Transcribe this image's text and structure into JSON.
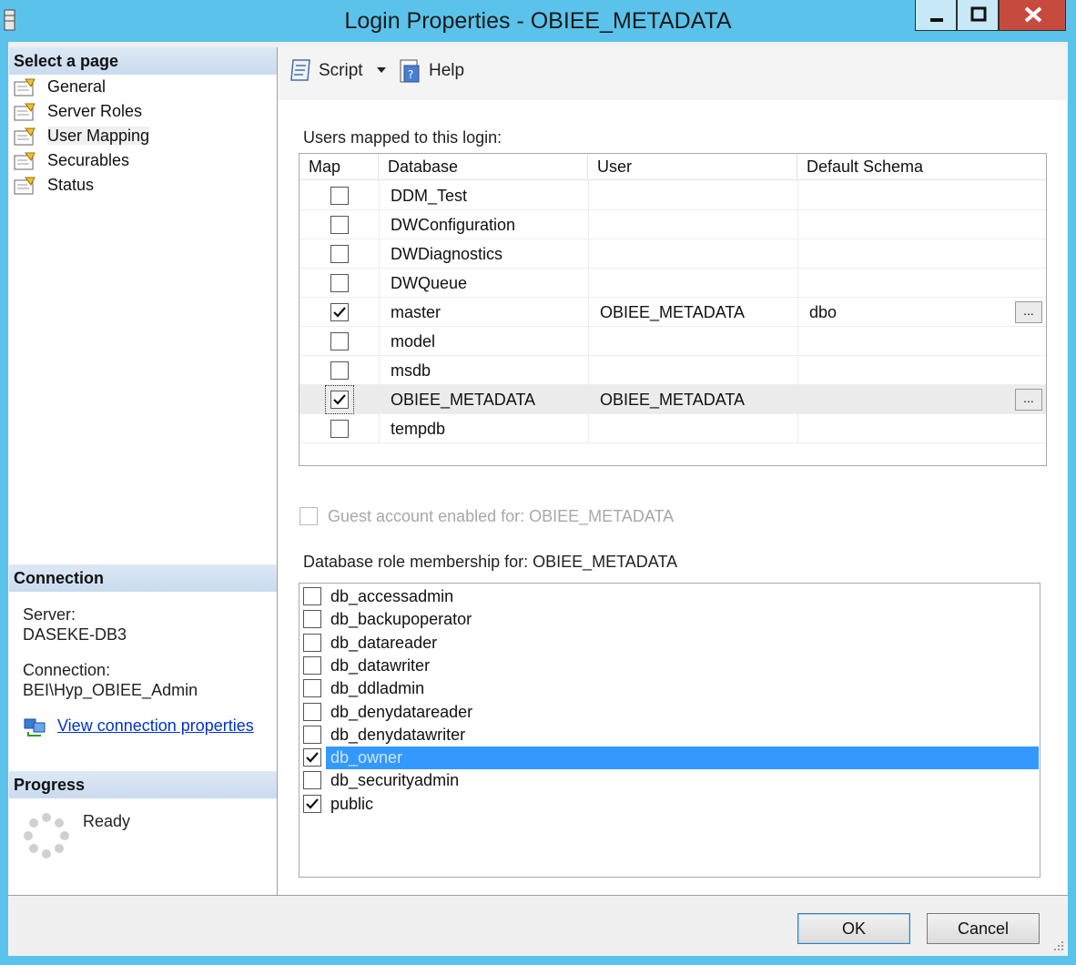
{
  "window": {
    "title": "Login Properties - OBIEE_METADATA"
  },
  "left": {
    "select_page_header": "Select a page",
    "pages": [
      {
        "label": "General"
      },
      {
        "label": "Server Roles"
      },
      {
        "label": "User Mapping"
      },
      {
        "label": "Securables"
      },
      {
        "label": "Status"
      }
    ],
    "connection_header": "Connection",
    "server_label": "Server:",
    "server_value": "DASEKE-DB3",
    "connection_label": "Connection:",
    "connection_value": "BEI\\Hyp_OBIEE_Admin",
    "view_link": "View connection properties",
    "progress_header": "Progress",
    "progress_status": "Ready"
  },
  "toolbar": {
    "script_label": "Script",
    "help_label": "Help"
  },
  "mapping": {
    "label": "Users mapped to this login:",
    "columns": [
      "Map",
      "Database",
      "User",
      "Default Schema"
    ],
    "rows": [
      {
        "checked": false,
        "database": "DDM_Test",
        "user": "",
        "schema": ""
      },
      {
        "checked": false,
        "database": "DWConfiguration",
        "user": "",
        "schema": ""
      },
      {
        "checked": false,
        "database": "DWDiagnostics",
        "user": "",
        "schema": ""
      },
      {
        "checked": false,
        "database": "DWQueue",
        "user": "",
        "schema": ""
      },
      {
        "checked": true,
        "database": "master",
        "user": "OBIEE_METADATA",
        "schema": "dbo",
        "ellipsis": "..."
      },
      {
        "checked": false,
        "database": "model",
        "user": "",
        "schema": ""
      },
      {
        "checked": false,
        "database": "msdb",
        "user": "",
        "schema": ""
      },
      {
        "checked": true,
        "database": "OBIEE_METADATA",
        "user": "OBIEE_METADATA",
        "schema": "",
        "ellipsis": "..."
      },
      {
        "checked": false,
        "database": "tempdb",
        "user": "",
        "schema": ""
      }
    ]
  },
  "guest": {
    "label": "Guest account enabled for: OBIEE_METADATA"
  },
  "roles": {
    "label": "Database role membership for: OBIEE_METADATA",
    "items": [
      {
        "name": "db_accessadmin",
        "checked": false
      },
      {
        "name": "db_backupoperator",
        "checked": false
      },
      {
        "name": "db_datareader",
        "checked": false
      },
      {
        "name": "db_datawriter",
        "checked": false
      },
      {
        "name": "db_ddladmin",
        "checked": false
      },
      {
        "name": "db_denydatareader",
        "checked": false
      },
      {
        "name": "db_denydatawriter",
        "checked": false
      },
      {
        "name": "db_owner",
        "checked": true
      },
      {
        "name": "db_securityadmin",
        "checked": false
      },
      {
        "name": "public",
        "checked": true
      }
    ]
  },
  "buttons": {
    "ok": "OK",
    "cancel": "Cancel"
  },
  "colors": {
    "titlebar": "#5bc3eb",
    "selection": "#3399ff",
    "close": "#c74a3e",
    "link": "#0033cc"
  }
}
